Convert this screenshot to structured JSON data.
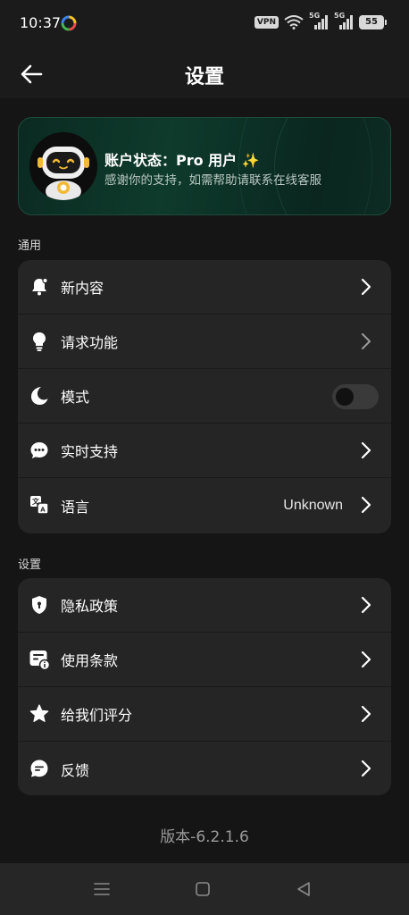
{
  "status_bar": {
    "time": "10:37",
    "vpn": "VPN",
    "network_1": "5G",
    "network_2": "5G",
    "battery": "55"
  },
  "header": {
    "title": "设置",
    "back_icon": "arrow-left-icon"
  },
  "account": {
    "status": "账户状态：Pro 用户",
    "sparkle": "✨",
    "description": "感谢你的支持，如需帮助请联系在线客服",
    "avatar_icon": "robot-avatar-icon"
  },
  "general": {
    "section_label": "通用",
    "items": [
      {
        "label": "新内容",
        "icon": "bell-icon"
      },
      {
        "label": "请求功能",
        "icon": "lightbulb-icon"
      },
      {
        "label": "模式",
        "icon": "moon-icon",
        "toggle_on": false
      },
      {
        "label": "实时支持",
        "icon": "chat-support-icon"
      },
      {
        "label": "语言",
        "icon": "translate-icon",
        "value": "Unknown"
      }
    ]
  },
  "settings": {
    "section_label": "设置",
    "items": [
      {
        "label": "隐私政策",
        "icon": "shield-icon"
      },
      {
        "label": "使用条款",
        "icon": "document-info-icon"
      },
      {
        "label": "给我们评分",
        "icon": "star-icon"
      },
      {
        "label": "反馈",
        "icon": "feedback-icon"
      }
    ]
  },
  "version": "版本-6.2.1.6",
  "colors": {
    "background": "#1b1b1b",
    "card": "#252525",
    "accent_green": "#0e3b2c"
  }
}
